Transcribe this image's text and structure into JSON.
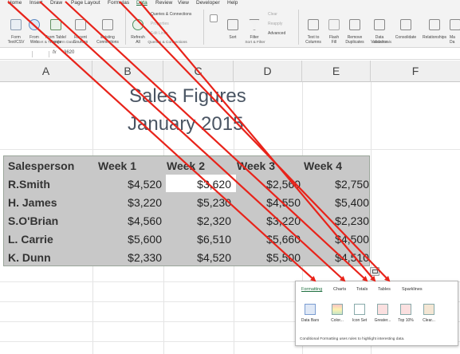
{
  "ribbon": {
    "menu_tabs": [
      "Home",
      "Insert",
      "Draw",
      "Page Layout",
      "Formulas",
      "Data",
      "Review",
      "View",
      "Developer",
      "Help"
    ],
    "active_tab": "Data",
    "buttons": {
      "from_text_csv": "Form\nText/CSV",
      "from_web": "From\nWeb",
      "from_table_range": "From Table/\nRange",
      "recent_sources": "Recent\nSources",
      "existing_connections": "Existing\nConnections",
      "refresh_all": "Refresh\nAll",
      "queries_connections": "Queries & Connections",
      "properties": "Properties",
      "edit_links": "Edit Links",
      "sort": "Sort",
      "filter": "Filter",
      "clear": "Clear",
      "reapply": "Reapply",
      "advanced": "Advanced",
      "text_to_columns": "Text to\nColumns",
      "flash_fill": "Flash\nFill",
      "remove_duplicates": "Remove\nDuplicates",
      "data_validation": "Data\nValidation",
      "consolidate": "Consolidate",
      "relationships": "Relationships",
      "manage_data_model": "Ma\nDa"
    },
    "groups": [
      "Get & Transform Data",
      "Queries & Connections",
      "Sort & Filter",
      "Data Tools"
    ]
  },
  "formula_bar": {
    "fx": "fx",
    "value": "3620"
  },
  "columns": [
    "A",
    "B",
    "C",
    "D",
    "E",
    "F"
  ],
  "sheet": {
    "title_line1": "Sales Figures",
    "title_line2": "January 2015",
    "headers": [
      "Salesperson",
      "Week 1",
      "Week 2",
      "Week 3",
      "Week 4"
    ],
    "rows": [
      {
        "name": "R.Smith",
        "values": [
          "$4,520",
          "$3,620",
          "$2,560",
          "$2,750"
        ]
      },
      {
        "name": "H. James",
        "values": [
          "$3,220",
          "$5,230",
          "$4,550",
          "$5,400"
        ]
      },
      {
        "name": "S.O'Brian",
        "values": [
          "$4,560",
          "$2,320",
          "$3,220",
          "$2,230"
        ]
      },
      {
        "name": "L. Carrie",
        "values": [
          "$5,600",
          "$6,510",
          "$5,660",
          "$4,500"
        ]
      },
      {
        "name": "K. Dunn",
        "values": [
          "$2,330",
          "$4,520",
          "$5,500",
          "$4,510"
        ]
      }
    ]
  },
  "quick_analysis": {
    "tabs": [
      "Formatting",
      "Charts",
      "Totals",
      "Tables",
      "Sparklines"
    ],
    "active_tab": "Formatting",
    "options": [
      "Data Bars",
      "Color...",
      "Icon Set",
      "Greater...",
      "Top 10%",
      "Clear..."
    ],
    "description": "Conditional Formatting uses rules to highlight interesting data."
  },
  "colors": {
    "arrow": "#e8231a",
    "table_fill": "#c8c8c8",
    "title_text": "#4a5563",
    "accent": "#1f6f3f"
  }
}
